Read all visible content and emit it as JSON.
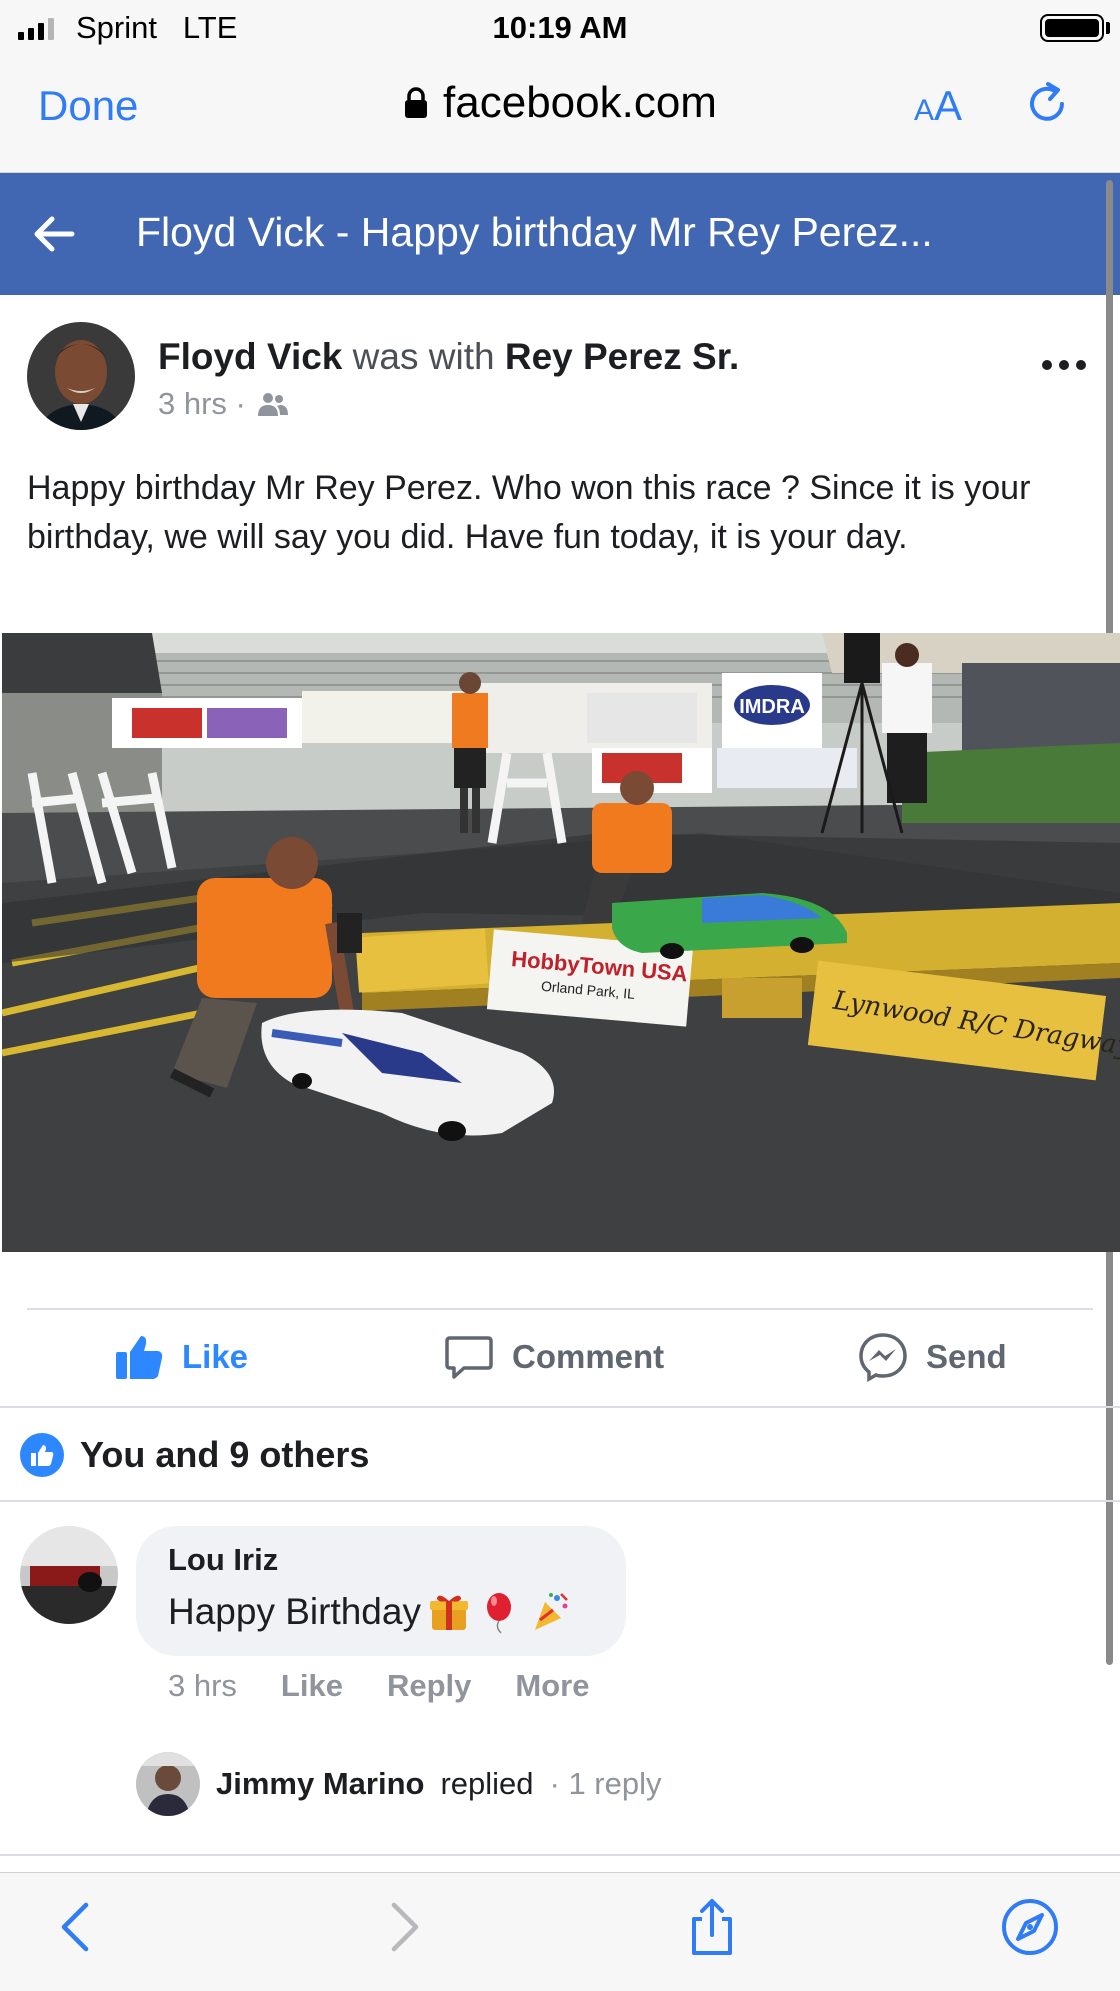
{
  "status_bar": {
    "carrier": "Sprint   LTE",
    "time": "10:19 AM"
  },
  "browser": {
    "done_label": "Done",
    "url": "facebook.com",
    "text_size_small": "A",
    "text_size_large": "A"
  },
  "fb_header": {
    "title": "Floyd Vick - Happy birthday Mr Rey Perez..."
  },
  "post": {
    "author": "Floyd Vick",
    "with_text": "was with",
    "tagged": "Rey Perez Sr.",
    "time": "3 hrs ·",
    "audience_icon": "friends-icon",
    "text": "Happy birthday Mr Rey Perez. Who won this race ? Since it is your birthday, we will say you did. Have fun today, it is your day."
  },
  "photo_signs": {
    "dragway": "Lynwood R/C Dragway",
    "hobbytown": "HobbyTown USA",
    "hobbytown_city": "Orland Park, IL",
    "imdra": "IMDRA"
  },
  "actions": {
    "like": "Like",
    "comment": "Comment",
    "send": "Send"
  },
  "reactions": {
    "summary": "You and 9 others"
  },
  "comment": {
    "author": "Lou Iriz",
    "text": "Happy Birthday",
    "time": "3 hrs",
    "like": "Like",
    "reply": "Reply",
    "more": "More"
  },
  "reply": {
    "author": "Jimmy Marino",
    "action": "replied",
    "count": "· 1 reply"
  },
  "colors": {
    "facebook_blue": "#4267b2",
    "ios_blue": "#2f7cf6",
    "like_blue": "#2d88ff"
  }
}
